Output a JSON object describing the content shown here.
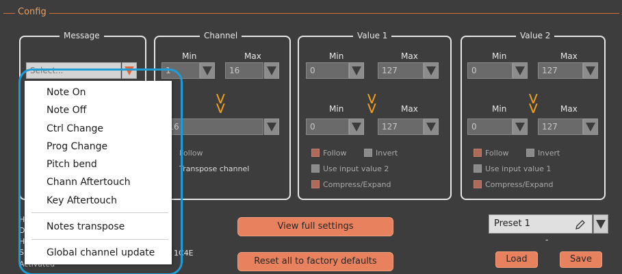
{
  "config": {
    "title": "Config"
  },
  "message": {
    "title": "Message",
    "select_value": "Select...",
    "menu": [
      "Note On",
      "Note Off",
      "Ctrl Change",
      "Prog Change",
      "Pitch bend",
      "Chann Aftertouch",
      "Key Aftertouch",
      "Notes transpose",
      "Global channel update"
    ]
  },
  "channel": {
    "title": "Channel",
    "min_label": "Min",
    "max_label": "Max",
    "min_value": "1",
    "max_value": "16",
    "out_value": "-16",
    "follow_label": "Follow",
    "transpose_label": "Transpose channel"
  },
  "value1": {
    "title": "Value 1",
    "min_label": "Min",
    "max_label": "Max",
    "min_value": "0",
    "max_value": "127",
    "out_min_label": "Min",
    "out_max_label": "Max",
    "out_min_value": "0",
    "out_max_value": "127",
    "follow_label": "Follow",
    "invert_label": "Invert",
    "use_input_label": "Use input value 2",
    "compress_label": "Compress/Expand"
  },
  "value2": {
    "title": "Value 2",
    "min_label": "Min",
    "max_label": "Max",
    "min_value": "0",
    "max_value": "127",
    "out_min_label": "Min",
    "out_max_label": "Max",
    "out_min_value": "0",
    "out_max_value": "127",
    "follow_label": "Follow",
    "invert_label": "Invert",
    "use_input_label": "Use input value 1",
    "compress_label": "Compress/Expand"
  },
  "footer": {
    "view_full_settings": "View full settings",
    "reset_defaults": "Reset all to factory defaults",
    "preset_value": "Preset 1",
    "preset_dash": "-",
    "load": "Load",
    "save": "Save",
    "info_fragments": [
      "H",
      "D",
      "H",
      "S",
      "1C4E",
      "Activated"
    ]
  },
  "colors": {
    "background": "#3d3d3d",
    "accent_orange": "#e8825e",
    "chevron": "#f0a020",
    "highlight_blue": "#1e9cd7"
  }
}
